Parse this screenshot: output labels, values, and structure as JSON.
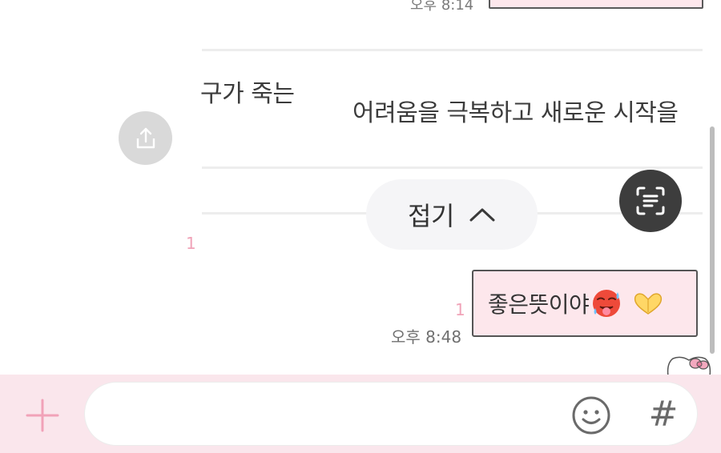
{
  "previous_message": {
    "time": "오후 8:14"
  },
  "card": {
    "line1": "구가 죽는",
    "line2": "어려움을 극복하고 새로운 시작을"
  },
  "fold_button": {
    "label": "접기"
  },
  "unread_counts": {
    "left": "1",
    "right": "1"
  },
  "message": {
    "text": "좋은뜻이야",
    "time": "오후 8:48",
    "emoji_icons": [
      "hot-face-icon",
      "heart-hands-icon"
    ]
  },
  "input": {
    "value": "",
    "placeholder": ""
  },
  "hashtag_button": {
    "label": "#"
  },
  "colors": {
    "bubble_bg": "#fde7ec",
    "input_bar_bg": "#fae6ec",
    "unread_pink": "#f0a3b8",
    "scan_button_bg": "#3d3d3d",
    "share_button_bg": "#d9d9d9",
    "fold_button_bg": "#f5f5f7"
  }
}
